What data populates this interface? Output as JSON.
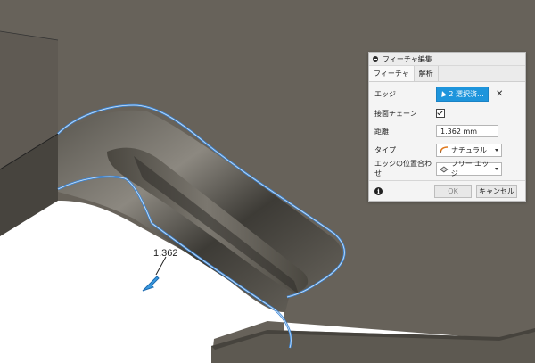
{
  "viewport": {
    "dimension_value": "1.362",
    "colors": {
      "solid_top": "#67625a",
      "solid_side": "#45423c",
      "background": "#ffffff",
      "edge_highlight": "#3d86d6"
    }
  },
  "dialog": {
    "title": "フィーチャ編集",
    "tabs": [
      "フィーチャ",
      "解析"
    ],
    "fields": {
      "edge_label": "エッジ",
      "edge_value": "2 選択済...",
      "tangent_label": "接面チェーン",
      "tangent_checked": true,
      "distance_label": "距離",
      "distance_value": "1.362 mm",
      "type_label": "タイプ",
      "type_value": "ナチュラル",
      "position_label": "エッジの位置合わせ",
      "position_value": "フリー エッジ"
    },
    "ok_label": "OK",
    "cancel_label": "キャンセル",
    "accent_color": "#1e95dc"
  }
}
